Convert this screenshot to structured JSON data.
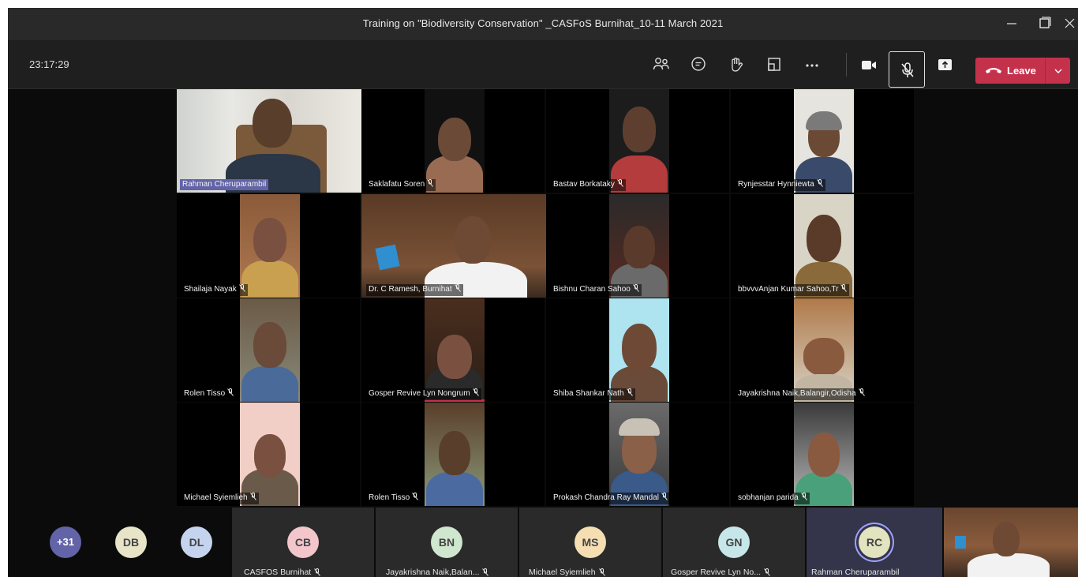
{
  "window": {
    "title": "Training on \"Biodiversity Conservation\" _CASFoS Burnihat_10-11 March 2021"
  },
  "toolbar": {
    "clock": "23:17:29",
    "icons": [
      "participants-icon",
      "chat-icon",
      "raise-hand-icon",
      "rooms-icon",
      "more-icon",
      "camera-icon",
      "mic-off-icon",
      "share-icon"
    ],
    "leave_label": "Leave",
    "leave_color": "#c4314b"
  },
  "participants": [
    {
      "name": "Rahman  Cheruparambil",
      "muted": false,
      "active_speaker": true
    },
    {
      "name": "Saklafatu Soren",
      "muted": true
    },
    {
      "name": "Bastav Borkataky",
      "muted": true
    },
    {
      "name": "Rynjesstar Hynniewta",
      "muted": true
    },
    {
      "name": "Shailaja Nayak",
      "muted": true
    },
    {
      "name": "Dr. C Ramesh, Burnihat",
      "muted": true
    },
    {
      "name": "Bishnu Charan Sahoo",
      "muted": true
    },
    {
      "name": "bbvvvAnjan Kumar Sahoo,Tr",
      "muted": true
    },
    {
      "name": "Rolen Tisso",
      "muted": true
    },
    {
      "name": "Gosper Revive Lyn Nongrum",
      "muted": true
    },
    {
      "name": "Shiba Shankar Nath",
      "muted": true
    },
    {
      "name": "Jayakrishna Naik,Balangir,Odisha",
      "muted": true
    },
    {
      "name": "Michael Syiemlieh",
      "muted": true
    },
    {
      "name": "Rolen Tisso",
      "muted": true
    },
    {
      "name": "Prokash Chandra Ray Mandal",
      "muted": true
    },
    {
      "name": "sobhanjan parida",
      "muted": true
    }
  ],
  "roster": {
    "overflow_count": "+31",
    "avatars": [
      {
        "initials": "DB",
        "color": "#e8e4c8"
      },
      {
        "initials": "DL",
        "color": "#c5d4ee"
      }
    ],
    "named": [
      {
        "initials": "CB",
        "color": "#f3c6cc",
        "name": "CASFOS Burnihat"
      },
      {
        "initials": "BN",
        "color": "#cfe6cf",
        "name": "Jayakrishna Naik,Balan..."
      },
      {
        "initials": "MS",
        "color": "#f6deb3",
        "name": "Michael Syiemlieh"
      },
      {
        "initials": "GN",
        "color": "#c6e6ea",
        "name": "Gosper Revive Lyn No..."
      },
      {
        "initials": "RC",
        "color": "#e2e3bf",
        "name": "Rahman Cheruparambil"
      }
    ]
  }
}
